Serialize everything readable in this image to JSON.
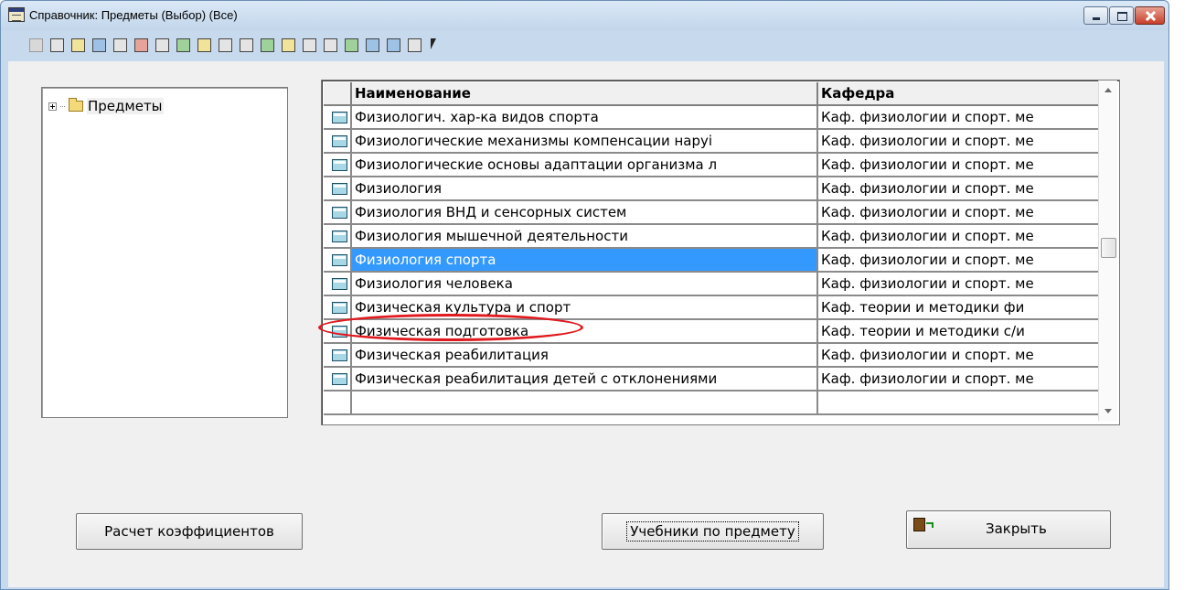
{
  "window": {
    "title": "Справочник: Предметы (Выбор) (Все)"
  },
  "toolbar": {
    "icons": [
      "disabled-icon",
      "form-icon",
      "table-icon",
      "find-icon",
      "filter-icon",
      "record-icon",
      "insert-icon",
      "move-in-icon",
      "move-out-icon",
      "list-icon",
      "copy-icon",
      "export-icon",
      "tools-icon",
      "paste-icon",
      "document-icon",
      "print-icon",
      "tree-icon",
      "screen-icon",
      "help-icon",
      "whats-this-icon"
    ]
  },
  "tree": {
    "root_label": "Предметы"
  },
  "grid": {
    "columns": [
      "Наименование",
      "Кафедра"
    ],
    "rows": [
      {
        "name": "Физиологич. хар-ка видов спорта",
        "dept": "Каф. физиологии и спорт. ме"
      },
      {
        "name": "Физиологические  механизмы компенсации наруі",
        "dept": "Каф. физиологии и спорт. ме"
      },
      {
        "name": "Физиологические основы адаптации организма л",
        "dept": "Каф. физиологии и спорт. ме"
      },
      {
        "name": "Физиология",
        "dept": "Каф. физиологии и спорт. ме"
      },
      {
        "name": "Физиология ВНД и сенсорных систем",
        "dept": "Каф. физиологии и спорт. ме"
      },
      {
        "name": "Физиология мышечной деятельности",
        "dept": "Каф. физиологии и спорт. ме"
      },
      {
        "name": "Физиология спорта",
        "dept": "Каф. физиологии и спорт. ме",
        "selected": true
      },
      {
        "name": "Физиология человека",
        "dept": "Каф. физиологии и спорт. ме"
      },
      {
        "name": "Физическая культура и спорт",
        "dept": "Каф. теории  и методики  фи"
      },
      {
        "name": "Физическая подготовка",
        "dept": "Каф. теории и методики с/и"
      },
      {
        "name": "Физическая реабилитация",
        "dept": "Каф. физиологии и спорт. ме"
      },
      {
        "name": "Физическая реабилитация детей с отклонениями",
        "dept": "Каф. физиологии и спорт. ме"
      },
      {
        "name": "",
        "dept": ""
      }
    ]
  },
  "buttons": {
    "calc_label": "Расчет коэффициентов",
    "books_label": "Учебники по предмету",
    "close_label": "Закрыть"
  }
}
